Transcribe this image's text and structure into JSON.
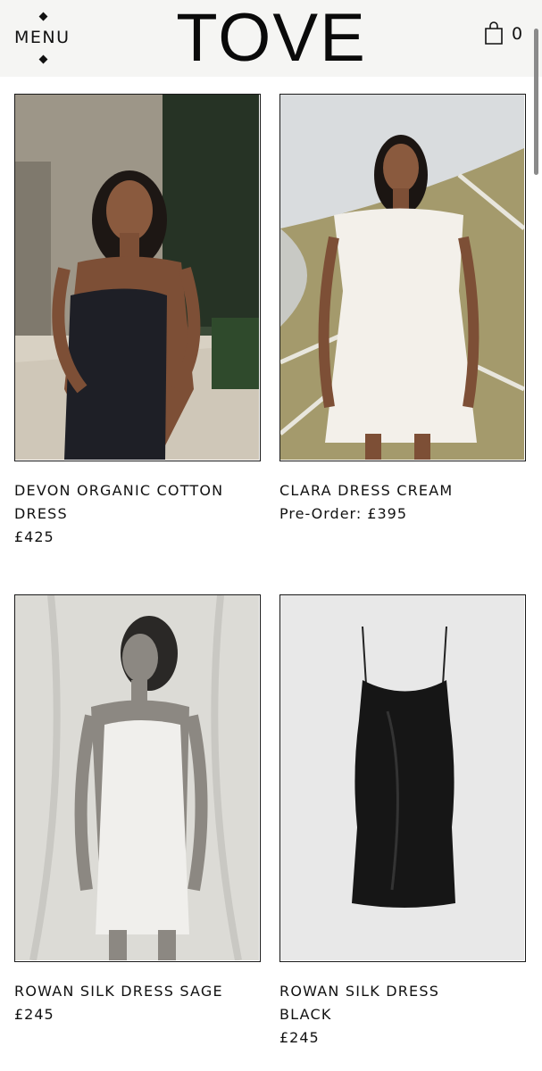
{
  "header": {
    "menu_label": "MENU",
    "logo": "TOVE",
    "cart_count": "0"
  },
  "products": [
    {
      "title": "DEVON ORGANIC COTTON DRESS",
      "price": "£425"
    },
    {
      "title": "CLARA DRESS CREAM",
      "price": "Pre-Order: £395"
    },
    {
      "title": "ROWAN SILK DRESS SAGE",
      "price": "£245"
    },
    {
      "title": "ROWAN SILK DRESS BLACK",
      "price": "£245"
    }
  ],
  "icons": {
    "menu": "diamond-dots-icon",
    "cart": "shopping-bag-icon"
  },
  "colors": {
    "header_bg": "#f5f5f3",
    "text": "#111111",
    "frame": "#1a1a1a"
  }
}
